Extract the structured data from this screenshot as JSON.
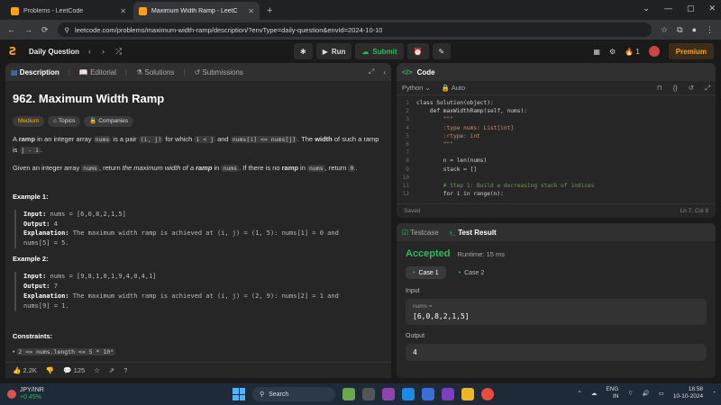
{
  "browser": {
    "tabs": [
      {
        "title": "Problems - LeetCode",
        "active": false
      },
      {
        "title": "Maximum Width Ramp - LeetC",
        "active": true
      }
    ],
    "url": "leetcode.com/problems/maximum-width-ramp/description/?envType=daily-question&envId=2024-10-10"
  },
  "nav": {
    "daily": "Daily Question",
    "run": "Run",
    "submit": "Submit",
    "fire_count": "1",
    "premium": "Premium"
  },
  "left_tabs": {
    "description": "Description",
    "editorial": "Editorial",
    "solutions": "Solutions",
    "submissions": "Submissions"
  },
  "problem": {
    "title": "962. Maximum Width Ramp",
    "difficulty": "Medium",
    "topics": "Topics",
    "companies": "Companies",
    "p1_a": "A ",
    "p1_ramp": "ramp",
    "p1_b": " in an integer array ",
    "p1_nums": "nums",
    "p1_c": " is a pair ",
    "p1_pair": "(i, j)",
    "p1_d": " for which ",
    "p1_cond1": "i < j",
    "p1_e": " and ",
    "p1_cond2": "nums[i] <= nums[j]",
    "p1_f": ". The ",
    "p1_width": "width",
    "p1_g": " of such a ramp is ",
    "p1_wval": "j - i",
    "p1_h": ".",
    "p2_a": "Given an integer array ",
    "p2_nums": "nums",
    "p2_b": ", return ",
    "p2_em": "the maximum width of a ",
    "p2_ramp": "ramp",
    "p2_c": " in ",
    "p2_nums2": "nums",
    "p2_d": ". If there is no ",
    "p2_ramp2": "ramp",
    "p2_e": " in ",
    "p2_nums3": "nums",
    "p2_f": ", return ",
    "p2_zero": "0",
    "p2_g": ".",
    "ex1_title": "Example 1:",
    "ex1_input_label": "Input:",
    "ex1_input": " nums = [6,0,8,2,1,5]",
    "ex1_output_label": "Output:",
    "ex1_output": " 4",
    "ex1_expl_label": "Explanation:",
    "ex1_expl": " The maximum width ramp is achieved at (i, j) = (1, 5): nums[1] = 0 and",
    "ex1_expl2": "nums[5] = 5.",
    "ex2_title": "Example 2:",
    "ex2_input_label": "Input:",
    "ex2_input": " nums = [9,8,1,0,1,9,4,0,4,1]",
    "ex2_output_label": "Output:",
    "ex2_output": " 7",
    "ex2_expl_label": "Explanation:",
    "ex2_expl": " The maximum width ramp is achieved at (i, j) = (2, 9): nums[2] = 1 and",
    "ex2_expl2": "nums[9] = 1.",
    "constraints_title": "Constraints:",
    "constraint1": "2 <= nums.length <= 5 * 10⁴"
  },
  "footer": {
    "likes": "2.2K",
    "comments": "125"
  },
  "code": {
    "tab": "Code",
    "language": "Python",
    "auto": "Auto",
    "lines": [
      {
        "n": "1",
        "t": "class Solution(object):"
      },
      {
        "n": "2",
        "t": "    def maxWidthRamp(self, nums):"
      },
      {
        "n": "3",
        "t": "        \"\"\""
      },
      {
        "n": "4",
        "t": "        :type nums: List[int]"
      },
      {
        "n": "5",
        "t": "        :rtype: int"
      },
      {
        "n": "6",
        "t": "        \"\"\""
      },
      {
        "n": "7",
        "t": ""
      },
      {
        "n": "8",
        "t": "        n = len(nums)"
      },
      {
        "n": "9",
        "t": "        stack = []"
      },
      {
        "n": "10",
        "t": ""
      },
      {
        "n": "11",
        "t": "        # Step 1: Build a decreasing stack of indices"
      },
      {
        "n": "12",
        "t": "        for i in range(n):"
      }
    ],
    "saved": "Saved",
    "position": "Ln 7, Col 9"
  },
  "test": {
    "testcase_tab": "Testcase",
    "result_tab": "Test Result",
    "status": "Accepted",
    "runtime": "Runtime: 15 ms",
    "case1": "Case 1",
    "case2": "Case 2",
    "input_label": "Input",
    "input_var": "nums =",
    "input_value": "[6,0,8,2,1,5]",
    "output_label": "Output",
    "output_value": "4"
  },
  "taskbar": {
    "ticker": "JPY/INR",
    "change": "+0.45%",
    "search": "Search",
    "lang1": "ENG",
    "lang2": "IN",
    "time": "18:58",
    "date": "10-10-2024"
  },
  "colors": {
    "accent": "#ffa116",
    "success": "#2cbb5d",
    "medium": "#ffb800"
  }
}
